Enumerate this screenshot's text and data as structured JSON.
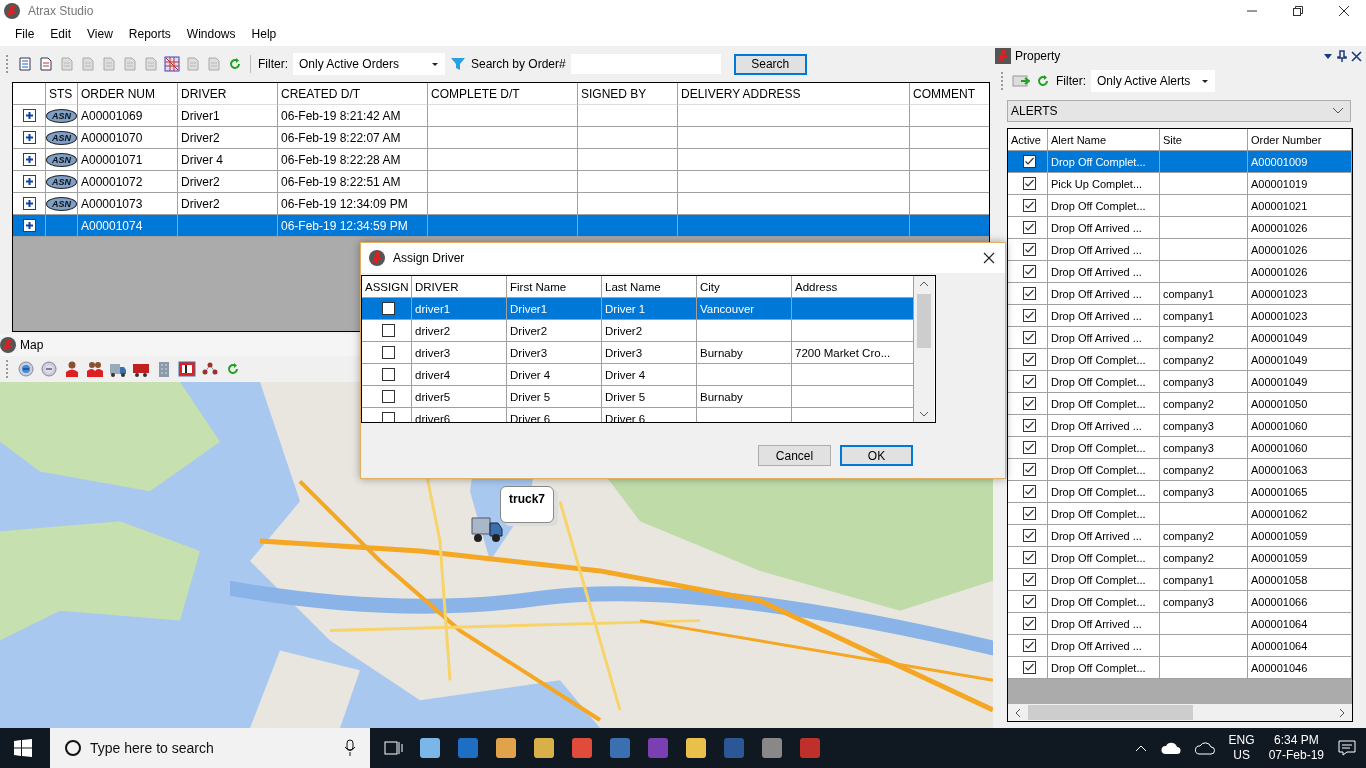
{
  "window": {
    "title": "Atrax Studio"
  },
  "menu": [
    "File",
    "Edit",
    "View",
    "Reports",
    "Windows",
    "Help"
  ],
  "orders_toolbar": {
    "filter_label": "Filter:",
    "filter_value": "Only Active Orders",
    "search_label": "Search by Order#",
    "search_button": "Search"
  },
  "orders": {
    "columns": [
      "STS",
      "ORDER NUM",
      "DRIVER",
      "CREATED D/T",
      "COMPLETE D/T",
      "SIGNED BY",
      "DELIVERY ADDRESS",
      "COMMENT"
    ],
    "rows": [
      {
        "status": "ASN",
        "order": "A00001069",
        "driver": "Driver1",
        "created": "06-Feb-19 8:21:42 AM",
        "selected": false
      },
      {
        "status": "ASN",
        "order": "A00001070",
        "driver": "Driver2",
        "created": "06-Feb-19 8:22:07 AM",
        "selected": false
      },
      {
        "status": "ASN",
        "order": "A00001071",
        "driver": "Driver 4",
        "created": "06-Feb-19 8:22:28 AM",
        "selected": false
      },
      {
        "status": "ASN",
        "order": "A00001072",
        "driver": "Driver2",
        "created": "06-Feb-19 8:22:51 AM",
        "selected": false
      },
      {
        "status": "ASN",
        "order": "A00001073",
        "driver": "Driver2",
        "created": "06-Feb-19 12:34:09 PM",
        "selected": false
      },
      {
        "order": "A00001074",
        "created": "06-Feb-19 12:34:59 PM",
        "selected": true
      }
    ]
  },
  "map": {
    "title": "Map",
    "marker": "truck7"
  },
  "dialog": {
    "title": "Assign Driver",
    "columns": [
      "ASSIGN",
      "DRIVER",
      "First Name",
      "Last Name",
      "City",
      "Address"
    ],
    "rows": [
      {
        "assign": false,
        "driver": "driver1",
        "first": "Driver1",
        "last": "Driver 1",
        "city": "Vancouver",
        "selected": true
      },
      {
        "assign": false,
        "driver": "driver2",
        "first": "Driver2",
        "last": "Driver2",
        "selected": false
      },
      {
        "assign": false,
        "driver": "driver3",
        "first": "Driver3",
        "last": "Driver3",
        "city": "Burnaby",
        "address": "7200 Market Cro...",
        "selected": false
      },
      {
        "assign": false,
        "driver": "driver4",
        "first": "Driver 4",
        "last": "Driver 4",
        "selected": false
      },
      {
        "assign": false,
        "driver": "driver5",
        "first": "Driver 5",
        "last": "Driver 5",
        "city": "Burnaby",
        "selected": false
      },
      {
        "assign": false,
        "driver": "driver6",
        "first": "Driver 6",
        "last": "Driver 6",
        "selected": false
      }
    ],
    "buttons": [
      "Cancel",
      "OK"
    ]
  },
  "property": {
    "title": "Property",
    "filter_label": "Filter:",
    "filter_value": "Only Active Alerts",
    "category": "ALERTS",
    "columns": [
      "Active",
      "Alert Name",
      "Site",
      "Order Number"
    ],
    "rows": [
      {
        "active": true,
        "name": "Drop Off Complet...",
        "order": "A00001009",
        "selected": true
      },
      {
        "active": true,
        "name": "Pick Up Complet...",
        "order": "A00001019",
        "selected": false
      },
      {
        "active": true,
        "name": "Drop Off Complet...",
        "order": "A00001021",
        "selected": false
      },
      {
        "active": true,
        "name": "Drop Off Arrived ...",
        "order": "A00001026",
        "selected": false
      },
      {
        "active": true,
        "name": "Drop Off Arrived ...",
        "order": "A00001026",
        "selected": false
      },
      {
        "active": true,
        "name": "Drop Off Arrived ...",
        "order": "A00001026",
        "selected": false
      },
      {
        "active": true,
        "name": "Drop Off Arrived ...",
        "site": "company1",
        "order": "A00001023",
        "selected": false
      },
      {
        "active": true,
        "name": "Drop Off Arrived ...",
        "site": "company1",
        "order": "A00001023",
        "selected": false
      },
      {
        "active": true,
        "name": "Drop Off Arrived ...",
        "site": "company2",
        "order": "A00001049",
        "selected": false
      },
      {
        "active": true,
        "name": "Drop Off Complet...",
        "site": "company2",
        "order": "A00001049",
        "selected": false
      },
      {
        "active": true,
        "name": "Drop Off Complet...",
        "site": "company3",
        "order": "A00001049",
        "selected": false
      },
      {
        "active": true,
        "name": "Drop Off Complet...",
        "site": "company2",
        "order": "A00001050",
        "selected": false
      },
      {
        "active": true,
        "name": "Drop Off Arrived ...",
        "site": "company3",
        "order": "A00001060",
        "selected": false
      },
      {
        "active": true,
        "name": "Drop Off Complet...",
        "site": "company3",
        "order": "A00001060",
        "selected": false
      },
      {
        "active": true,
        "name": "Drop Off Complet...",
        "site": "company2",
        "order": "A00001063",
        "selected": false
      },
      {
        "active": true,
        "name": "Drop Off Complet...",
        "site": "company3",
        "order": "A00001065",
        "selected": false
      },
      {
        "active": true,
        "name": "Drop Off Complet...",
        "order": "A00001062",
        "selected": false
      },
      {
        "active": true,
        "name": "Drop Off Arrived ...",
        "site": "company2",
        "order": "A00001059",
        "selected": false
      },
      {
        "active": true,
        "name": "Drop Off Complet...",
        "site": "company2",
        "order": "A00001059",
        "selected": false
      },
      {
        "active": true,
        "name": "Drop Off Complet...",
        "site": "company1",
        "order": "A00001058",
        "selected": false
      },
      {
        "active": true,
        "name": "Drop Off Complet...",
        "site": "company3",
        "order": "A00001066",
        "selected": false
      },
      {
        "active": true,
        "name": "Drop Off Arrived ...",
        "order": "A00001064",
        "selected": false
      },
      {
        "active": true,
        "name": "Drop Off Arrived ...",
        "order": "A00001064",
        "selected": false
      },
      {
        "active": true,
        "name": "Drop Off Complet...",
        "order": "A00001046",
        "selected": false
      }
    ]
  },
  "taskbar": {
    "search_placeholder": "Type here to search",
    "language": "ENG",
    "region": "US",
    "time": "6:34 PM",
    "date": "07-Feb-19"
  }
}
